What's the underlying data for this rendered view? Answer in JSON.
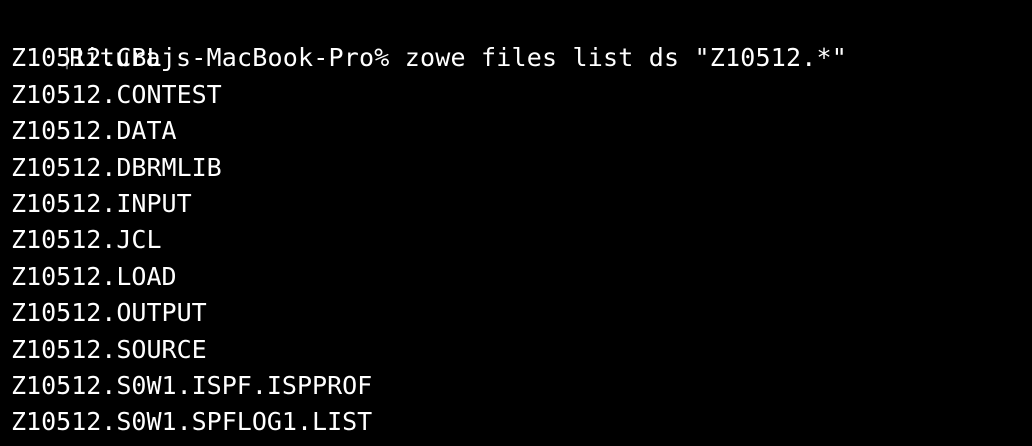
{
  "terminal": {
    "prompt_bracket": "[",
    "prompt": "Riturajs-MacBook-Pro%",
    "command": "zowe files list ds \"Z10512.*\"",
    "output": [
      "Z10512.CBL",
      "Z10512.CONTEST",
      "Z10512.DATA",
      "Z10512.DBRMLIB",
      "Z10512.INPUT",
      "Z10512.JCL",
      "Z10512.LOAD",
      "Z10512.OUTPUT",
      "Z10512.SOURCE",
      "Z10512.S0W1.ISPF.ISPPROF",
      "Z10512.S0W1.SPFLOG1.LIST"
    ],
    "colors": {
      "background": "#000000",
      "foreground": "#ffffff",
      "bracket": "#6e6e6e"
    }
  }
}
